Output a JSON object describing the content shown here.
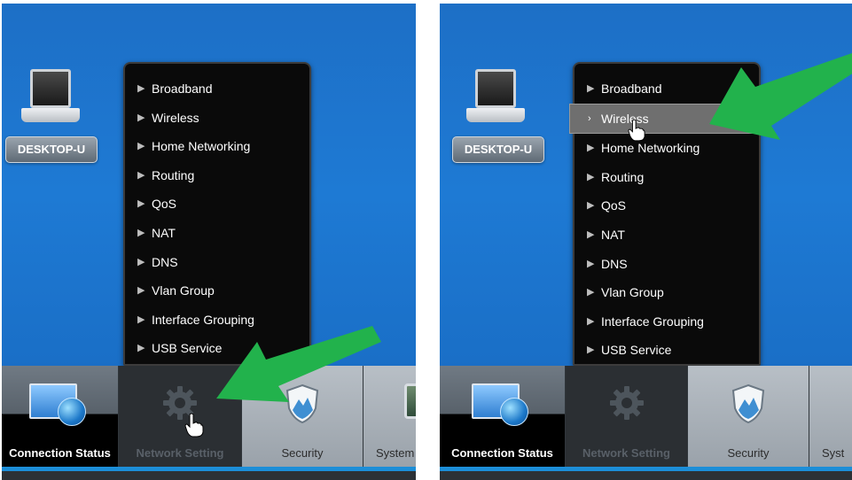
{
  "device": {
    "label": "DESKTOP-U"
  },
  "menu": {
    "items": [
      {
        "label": "Broadband"
      },
      {
        "label": "Wireless"
      },
      {
        "label": "Home Networking"
      },
      {
        "label": "Routing"
      },
      {
        "label": "QoS"
      },
      {
        "label": "NAT"
      },
      {
        "label": "DNS"
      },
      {
        "label": "Vlan Group"
      },
      {
        "label": "Interface Grouping"
      },
      {
        "label": "USB Service"
      }
    ],
    "highlighted_in_right_panel": "Wireless"
  },
  "tabs": {
    "connection_status": "Connection Status",
    "network_setting": "Network Setting",
    "security": "Security",
    "system": "System",
    "system_right": "Syst"
  },
  "colors": {
    "background": "#1e7ad4",
    "menu_bg": "#0a0a0a",
    "highlight": "#6f6f6f",
    "arrow": "#22b24c",
    "accent_strip": "#1c8ed8"
  },
  "icons": [
    "laptop-icon",
    "globe-icon",
    "gear-icon",
    "shield-icon",
    "system-icon",
    "hand-cursor-icon",
    "green-arrow-icon"
  ]
}
